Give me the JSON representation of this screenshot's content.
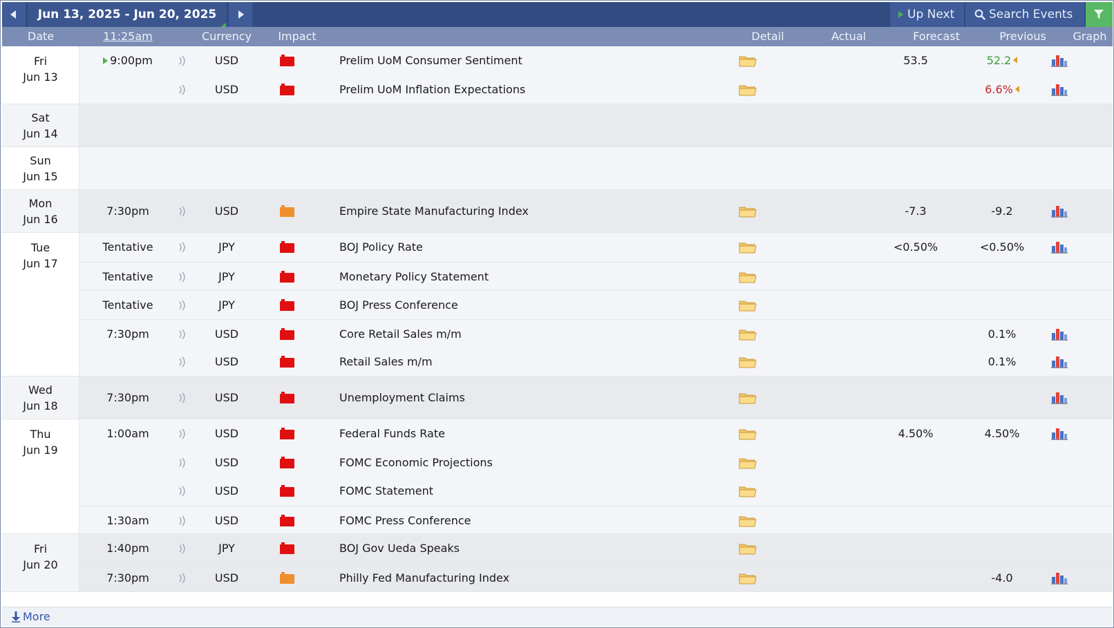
{
  "toolbar": {
    "date_range": "Jun 13, 2025 - Jun 20, 2025",
    "up_next": "Up Next",
    "search_events": "Search Events",
    "accent_color": "#59b865"
  },
  "header": {
    "date": "Date",
    "time": "11:25am",
    "currency": "Currency",
    "impact": "Impact",
    "detail": "Detail",
    "actual": "Actual",
    "forecast": "Forecast",
    "previous": "Previous",
    "graph": "Graph"
  },
  "days": [
    {
      "weekday": "Fri",
      "date": "Jun 13"
    },
    {
      "weekday": "Sat",
      "date": "Jun 14"
    },
    {
      "weekday": "Sun",
      "date": "Jun 15"
    },
    {
      "weekday": "Mon",
      "date": "Jun 16"
    },
    {
      "weekday": "Tue",
      "date": "Jun 17"
    },
    {
      "weekday": "Wed",
      "date": "Jun 18"
    },
    {
      "weekday": "Thu",
      "date": "Jun 19"
    },
    {
      "weekday": "Fri",
      "date": "Jun 20"
    }
  ],
  "events": [
    {
      "time": "9:00pm",
      "currency": "USD",
      "impact": "high",
      "name": "Prelim UoM Consumer Sentiment",
      "forecast": "53.5",
      "previous": "52.2",
      "previous_color": "green",
      "revised": true,
      "graph": true,
      "next": true
    },
    {
      "time": "",
      "currency": "USD",
      "impact": "high",
      "name": "Prelim UoM Inflation Expectations",
      "forecast": "",
      "previous": "6.6%",
      "previous_color": "red",
      "revised": true,
      "graph": true
    },
    {
      "time": "7:30pm",
      "currency": "USD",
      "impact": "medium",
      "name": "Empire State Manufacturing Index",
      "forecast": "-7.3",
      "previous": "-9.2",
      "graph": true
    },
    {
      "time": "Tentative",
      "currency": "JPY",
      "impact": "high",
      "name": "BOJ Policy Rate",
      "forecast": "<0.50%",
      "previous": "<0.50%",
      "graph": true
    },
    {
      "time": "Tentative",
      "currency": "JPY",
      "impact": "high",
      "name": "Monetary Policy Statement",
      "forecast": "",
      "previous": ""
    },
    {
      "time": "Tentative",
      "currency": "JPY",
      "impact": "high",
      "name": "BOJ Press Conference",
      "forecast": "",
      "previous": ""
    },
    {
      "time": "7:30pm",
      "currency": "USD",
      "impact": "high",
      "name": "Core Retail Sales m/m",
      "forecast": "",
      "previous": "0.1%",
      "graph": true
    },
    {
      "time": "",
      "currency": "USD",
      "impact": "high",
      "name": "Retail Sales m/m",
      "forecast": "",
      "previous": "0.1%",
      "graph": true
    },
    {
      "time": "7:30pm",
      "currency": "USD",
      "impact": "high",
      "name": "Unemployment Claims",
      "forecast": "",
      "previous": "",
      "graph": true
    },
    {
      "time": "1:00am",
      "currency": "USD",
      "impact": "high",
      "name": "Federal Funds Rate",
      "forecast": "4.50%",
      "previous": "4.50%",
      "graph": true
    },
    {
      "time": "",
      "currency": "USD",
      "impact": "high",
      "name": "FOMC Economic Projections",
      "forecast": "",
      "previous": ""
    },
    {
      "time": "",
      "currency": "USD",
      "impact": "high",
      "name": "FOMC Statement",
      "forecast": "",
      "previous": ""
    },
    {
      "time": "1:30am",
      "currency": "USD",
      "impact": "high",
      "name": "FOMC Press Conference",
      "forecast": "",
      "previous": ""
    },
    {
      "time": "1:40pm",
      "currency": "JPY",
      "impact": "high",
      "name": "BOJ Gov Ueda Speaks",
      "forecast": "",
      "previous": ""
    },
    {
      "time": "7:30pm",
      "currency": "USD",
      "impact": "medium",
      "name": "Philly Fed Manufacturing Index",
      "forecast": "",
      "previous": "-4.0",
      "graph": true
    }
  ],
  "footer": {
    "more": "More"
  }
}
